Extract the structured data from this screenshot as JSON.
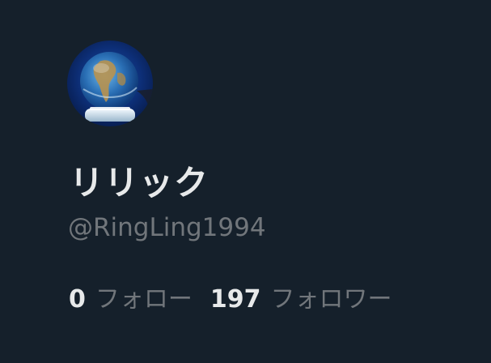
{
  "profile": {
    "display_name": "リリック",
    "handle": "@RingLing1994",
    "avatar": {
      "icon": "globe-avatar",
      "description_colors": [
        "#0b2a6b",
        "#2f7bc0",
        "#c9a15c",
        "#e8f2f7"
      ]
    }
  },
  "stats": {
    "following": {
      "count": "0",
      "label": "フォロー"
    },
    "followers": {
      "count": "197",
      "label": "フォロワー"
    }
  },
  "colors": {
    "background": "#15202b",
    "primary_text": "#e7e9ea",
    "secondary_text": "#71767b"
  }
}
